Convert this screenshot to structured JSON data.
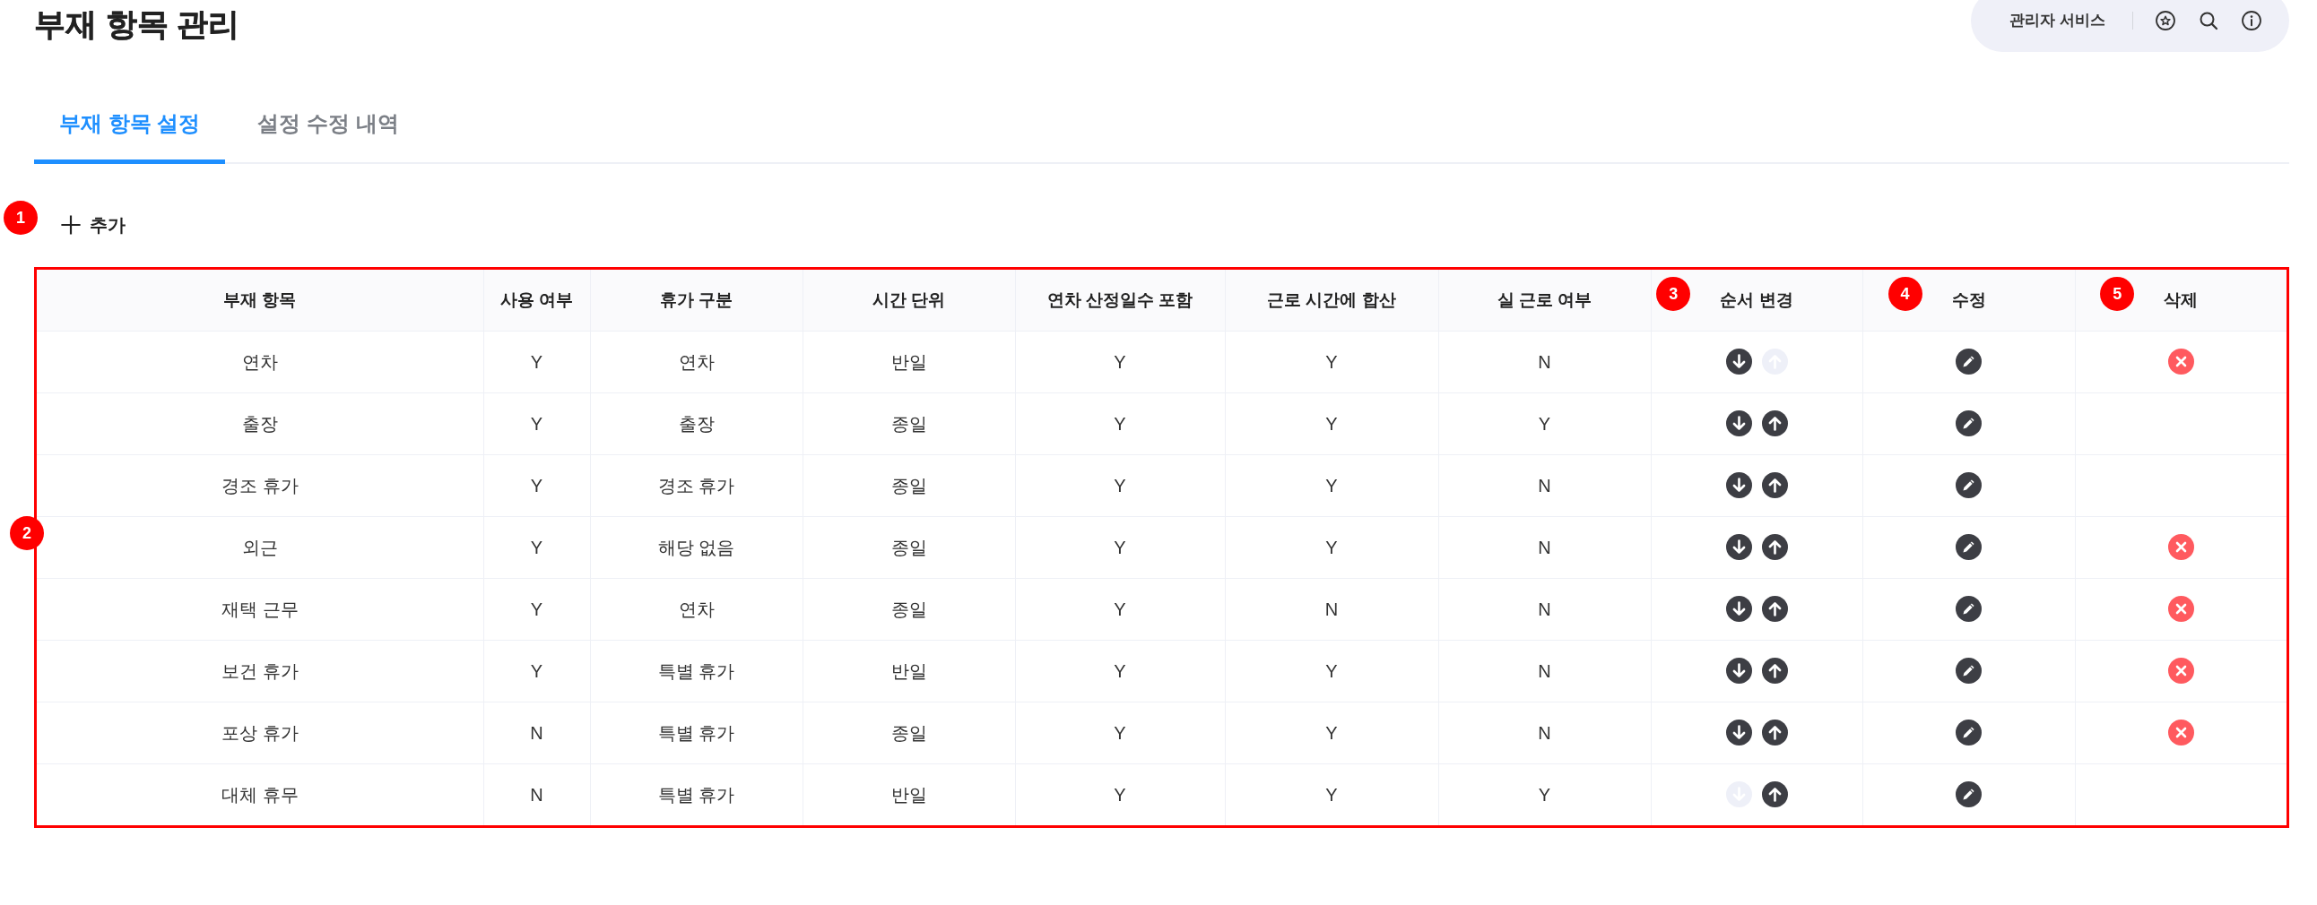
{
  "header": {
    "title": "부재 항목 관리",
    "admin_menu": {
      "label": "관리자 서비스"
    }
  },
  "tabs": [
    {
      "label": "부재 항목 설정",
      "selected": true
    },
    {
      "label": "설정 수정 내역",
      "selected": false
    }
  ],
  "add_button": {
    "label": "추가",
    "annotation": {
      "label": "1"
    }
  },
  "table": {
    "annotation": {
      "label": "2",
      "frame": true
    },
    "columns": [
      {
        "label": "부재 항목",
        "kind": "text"
      },
      {
        "label": "사용 여부",
        "kind": "text"
      },
      {
        "label": "휴가 구분",
        "kind": "text"
      },
      {
        "label": "시간 단위",
        "kind": "text"
      },
      {
        "label": "연차 산정일수 포함",
        "kind": "text"
      },
      {
        "label": "근로 시간에 합산",
        "kind": "text"
      },
      {
        "label": "실 근로 여부",
        "kind": "text"
      },
      {
        "label": "순서 변경",
        "kind": "order",
        "annotation": {
          "label": "3"
        }
      },
      {
        "label": "수정",
        "kind": "edit",
        "annotation": {
          "label": "4"
        }
      },
      {
        "label": "삭제",
        "kind": "delete",
        "annotation": {
          "label": "5"
        }
      }
    ],
    "rows": [
      {
        "cells": [
          "연차",
          "Y",
          "연차",
          "반일",
          "Y",
          "Y",
          "N"
        ],
        "down_disabled": false,
        "up_disabled": true,
        "deletable": true
      },
      {
        "cells": [
          "출장",
          "Y",
          "출장",
          "종일",
          "Y",
          "Y",
          "Y"
        ],
        "down_disabled": false,
        "up_disabled": false,
        "deletable": false
      },
      {
        "cells": [
          "경조 휴가",
          "Y",
          "경조 휴가",
          "종일",
          "Y",
          "Y",
          "N"
        ],
        "down_disabled": false,
        "up_disabled": false,
        "deletable": false
      },
      {
        "cells": [
          "외근",
          "Y",
          "해당 없음",
          "종일",
          "Y",
          "Y",
          "N"
        ],
        "down_disabled": false,
        "up_disabled": false,
        "deletable": true
      },
      {
        "cells": [
          "재택 근무",
          "Y",
          "연차",
          "종일",
          "Y",
          "N",
          "N"
        ],
        "down_disabled": false,
        "up_disabled": false,
        "deletable": true
      },
      {
        "cells": [
          "보건 휴가",
          "Y",
          "특별 휴가",
          "반일",
          "Y",
          "Y",
          "N"
        ],
        "down_disabled": false,
        "up_disabled": false,
        "deletable": true
      },
      {
        "cells": [
          "포상 휴가",
          "N",
          "특별 휴가",
          "종일",
          "Y",
          "Y",
          "N"
        ],
        "down_disabled": false,
        "up_disabled": false,
        "deletable": true
      },
      {
        "cells": [
          "대체 휴무",
          "N",
          "특별 휴가",
          "반일",
          "Y",
          "Y",
          "Y"
        ],
        "down_disabled": true,
        "up_disabled": false,
        "deletable": false
      }
    ]
  }
}
